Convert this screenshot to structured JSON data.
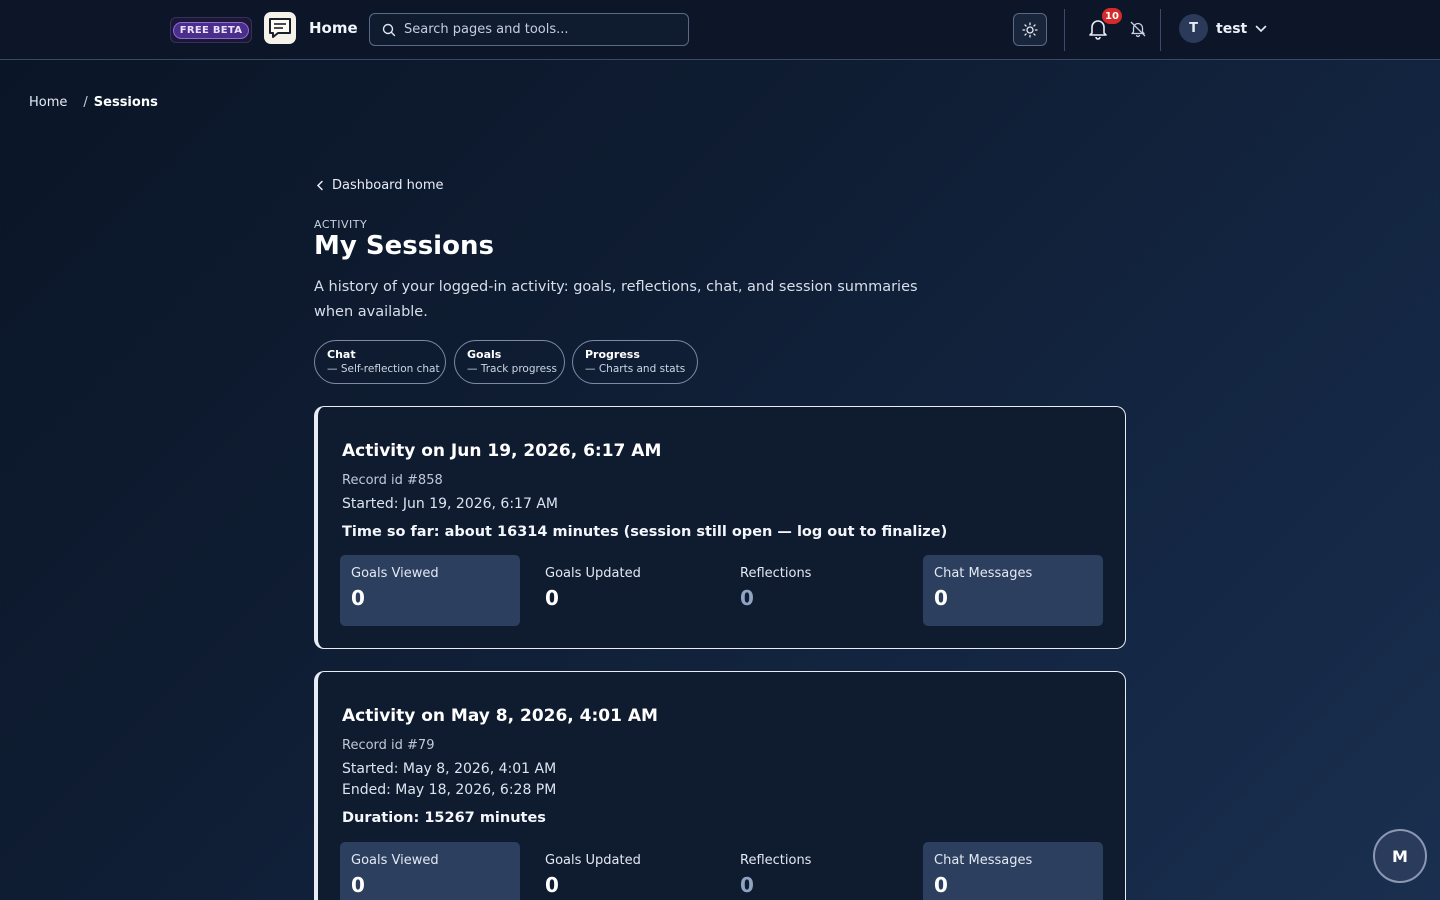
{
  "header": {
    "beta_label": "FREE BETA",
    "home_label": "Home",
    "search_placeholder": "Search pages and tools...",
    "notification_count": "10",
    "user_initial": "T",
    "user_name": "test"
  },
  "breadcrumb": {
    "home": "Home",
    "separator": "/",
    "current": "Sessions"
  },
  "main": {
    "back_label": "Dashboard home",
    "eyebrow": "ACTIVITY",
    "title": "My Sessions",
    "description": "A history of your logged-in activity: goals, reflections, chat, and session summaries when available.",
    "pills": [
      {
        "title": "Chat",
        "subtitle": "— Self-reflection chat"
      },
      {
        "title": "Goals",
        "subtitle": "— Track progress"
      },
      {
        "title": "Progress",
        "subtitle": "— Charts and stats"
      }
    ],
    "sessions": [
      {
        "title": "Activity on Jun 19, 2026, 6:17 AM",
        "record": "Record id #858",
        "started": "Started: Jun 19, 2026, 6:17 AM",
        "summary": "Time so far: about 16314 minutes (session still open — log out to finalize)",
        "stats": [
          {
            "label": "Goals Viewed",
            "value": "0"
          },
          {
            "label": "Goals Updated",
            "value": "0"
          },
          {
            "label": "Reflections",
            "value": "0"
          },
          {
            "label": "Chat Messages",
            "value": "0"
          }
        ]
      },
      {
        "title": "Activity on May 8, 2026, 4:01 AM",
        "record": "Record id #79",
        "started": "Started: May 8, 2026, 4:01 AM",
        "ended": "Ended: May 18, 2026, 6:28 PM",
        "summary": "Duration: 15267 minutes",
        "stats": [
          {
            "label": "Goals Viewed",
            "value": "0"
          },
          {
            "label": "Goals Updated",
            "value": "0"
          },
          {
            "label": "Reflections",
            "value": "0"
          },
          {
            "label": "Chat Messages",
            "value": "0"
          }
        ]
      }
    ]
  },
  "fab_label": "M",
  "colors": {
    "background": "#0f1d33",
    "topbar": "#0c1628",
    "stat_highlight": "#2c3f5e",
    "badge": "#d42a2a",
    "beta_accent": "#4b2d8a"
  }
}
